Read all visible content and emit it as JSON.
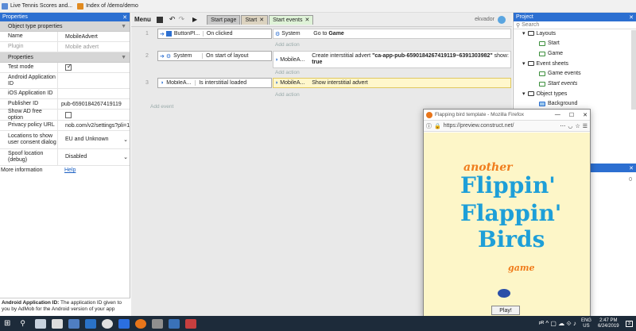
{
  "bookmarks": [
    {
      "label": "Live Tennis Scores and..."
    },
    {
      "label": "Index of /demo/demo"
    }
  ],
  "props": {
    "title": "Properties",
    "sec1": "Object type properties",
    "name_label": "Name",
    "name_value": "MobileAdvert",
    "plugin_label": "Plugin",
    "plugin_value": "Mobile advert",
    "sec2": "Properties",
    "test_mode": "Test mode",
    "android_id": "Android Application ID",
    "ios_id": "iOS Application ID",
    "publisher_label": "Publisher ID",
    "publisher_value": "pub-6590184267419119",
    "adfree": "Show AD free option",
    "privacy_label": "Privacy policy URL",
    "privacy_value": "nob.com/v2/settings?pli=1",
    "locations_label": "Locations to show user consent dialog",
    "locations_value": "EU and Unknown",
    "spoof_label": "Spoof location (debug)",
    "spoof_value": "Disabled",
    "more_label": "More information",
    "more_value": "Help",
    "desc_bold": "Android Application ID:",
    "desc_text": " The application ID given to you by AdMob for the Android version of your app"
  },
  "toolbar": {
    "menu": "Menu",
    "tabs": [
      "Start page",
      "Start",
      "Start events"
    ],
    "user": "ekvador"
  },
  "events": {
    "rows": [
      {
        "num": "1",
        "obj": "ButtonPl...",
        "cond": "On clicked",
        "act_obj": "System",
        "act": "Go to",
        "act_bold": "Game"
      },
      {
        "num": "2",
        "obj": "System",
        "cond": "On start of layout",
        "act_obj": "MobileA...",
        "act": "Create interstitial advert ",
        "act_bold": "\"ca-app-pub-6590184267419119~6391303982\"",
        "act_tail": " show: ",
        "act_tail_bold": "true"
      },
      {
        "num": "3",
        "obj": "MobileA...",
        "cond": "Is interstitial loaded",
        "act_obj": "MobileA...",
        "act": "Show interstitial advert"
      }
    ],
    "add_action": "Add action",
    "add_event": "Add event"
  },
  "project": {
    "title": "Project",
    "search": "Search",
    "layouts": "Layouts",
    "start": "Start",
    "game": "Game",
    "event_sheets": "Event sheets",
    "game_events": "Game events",
    "start_events": "Start events",
    "object_types": "Object types",
    "background": "Background",
    "zero": "0"
  },
  "firefox": {
    "title": "Flapping bird template - Mozilla Firefox",
    "url": "https://preview.construct.net/",
    "another": "another",
    "flippin": "Flippin'",
    "flappin": "Flappin'",
    "birds": "Birds",
    "game": "game",
    "play": "Play!"
  },
  "taskbar": {
    "lang": "ENG",
    "region": "US",
    "time": "2:47 PM",
    "date": "6/24/2019",
    "badge": "3"
  },
  "colors": {
    "accent": "#2c6fd1",
    "title_orange": "#f07c1c",
    "title_blue": "#1e9fd8",
    "game_bg": "#fdf6c8"
  }
}
